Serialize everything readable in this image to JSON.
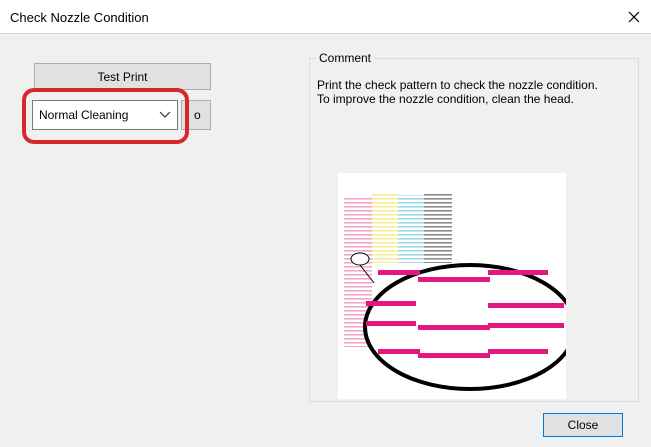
{
  "window": {
    "title": "Check Nozzle Condition"
  },
  "buttons": {
    "test_print": "Test Print",
    "partial": "o",
    "close": "Close"
  },
  "cleaning": {
    "selected": "Normal Cleaning"
  },
  "comment": {
    "label": "Comment",
    "lines": [
      "Print the check pattern to check the nozzle condition.",
      "To improve the nozzle condition, clean the head."
    ]
  },
  "colors": {
    "highlight": "#d7282e",
    "magenta": "#e3177f",
    "yellow": "#f7ec8f",
    "cyan": "#9fd9ec",
    "black": "#8a8a8a",
    "pink": "#f2a6c9"
  }
}
